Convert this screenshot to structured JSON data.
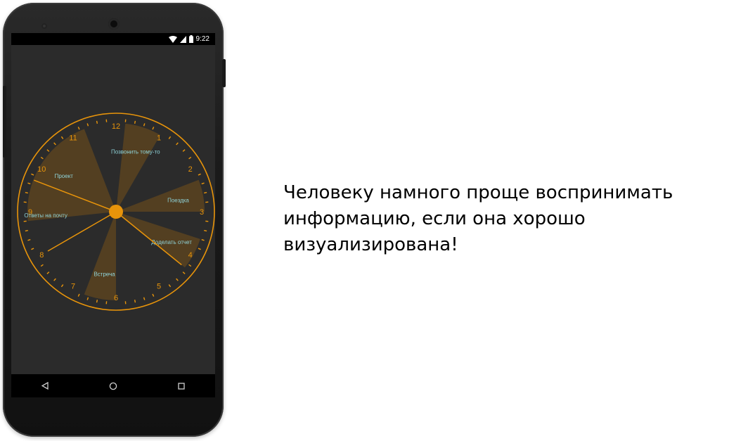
{
  "status_bar": {
    "time": "9:22",
    "icons": [
      "wifi-icon",
      "signal-icon",
      "battery-icon"
    ]
  },
  "clock": {
    "numerals": [
      "12",
      "1",
      "2",
      "3",
      "4",
      "5",
      "6",
      "7",
      "8",
      "9",
      "10",
      "11"
    ],
    "accent_color": "#e8940a",
    "sector_color": "#5a4320",
    "label_color": "#8fd3d8",
    "events": [
      {
        "label": "Позвонить тому-то",
        "start_hour": 12.2,
        "end_hour": 13.0
      },
      {
        "label": "Поездка",
        "start_hour": 14.3,
        "end_hour": 15.0
      },
      {
        "label": "Доделать отчет",
        "start_hour": 15.6,
        "end_hour": 16.3
      },
      {
        "label": "Встреча",
        "start_hour": 18.0,
        "end_hour": 18.7
      },
      {
        "label": "Ответы на почту",
        "start_hour": 20.8,
        "end_hour": 21.0
      },
      {
        "label": "Проект",
        "start_hour": 21.0,
        "end_hour": 23.3
      }
    ],
    "hands": {
      "hour_hand_hour": 8.0,
      "minute_hand_hour": 16.3,
      "second_hand_hour": 21.7
    }
  },
  "nav_bar": {
    "icons": [
      "back-icon",
      "home-icon",
      "recents-icon"
    ]
  },
  "caption": {
    "lines": [
      "Человеку намного проще воспринимать",
      "информацию, если она хорошо",
      "визуализирована!"
    ]
  }
}
